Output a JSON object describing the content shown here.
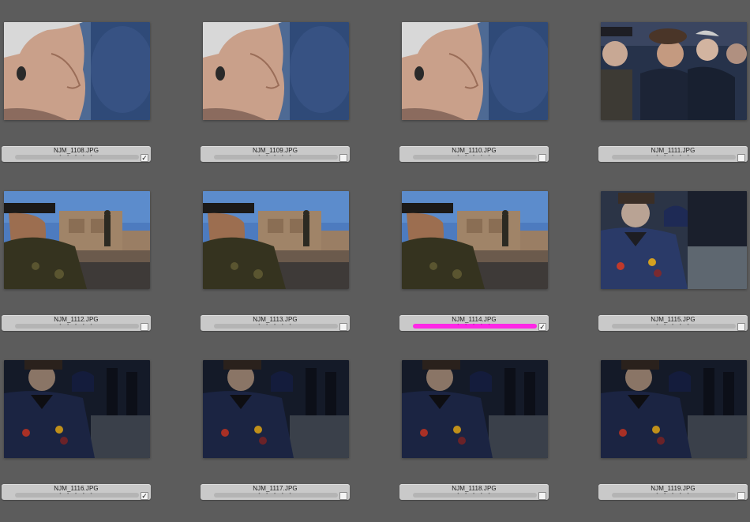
{
  "photos": [
    {
      "filename": "NJM_1108.JPG",
      "checked": true,
      "label_color": null,
      "subject": "man-profile-closeup"
    },
    {
      "filename": "NJM_1109.JPG",
      "checked": false,
      "label_color": null,
      "subject": "man-profile-closeup"
    },
    {
      "filename": "NJM_1110.JPG",
      "checked": false,
      "label_color": null,
      "subject": "man-profile-closeup"
    },
    {
      "filename": "NJM_1111.JPG",
      "checked": false,
      "label_color": null,
      "subject": "crowd-men-hats"
    },
    {
      "filename": "NJM_1112.JPG",
      "checked": false,
      "label_color": null,
      "subject": "soldier-memorial"
    },
    {
      "filename": "NJM_1113.JPG",
      "checked": false,
      "label_color": null,
      "subject": "soldier-memorial"
    },
    {
      "filename": "NJM_1114.JPG",
      "checked": true,
      "label_color": "#ff28e6",
      "subject": "soldier-memorial"
    },
    {
      "filename": "NJM_1115.JPG",
      "checked": false,
      "label_color": null,
      "subject": "veteran-medals"
    },
    {
      "filename": "NJM_1116.JPG",
      "checked": true,
      "label_color": null,
      "subject": "veteran-medals-dark"
    },
    {
      "filename": "NJM_1117.JPG",
      "checked": false,
      "label_color": null,
      "subject": "veteran-medals-dark"
    },
    {
      "filename": "NJM_1118.JPG",
      "checked": false,
      "label_color": null,
      "subject": "veteran-medals-dark"
    },
    {
      "filename": "NJM_1119.JPG",
      "checked": false,
      "label_color": null,
      "subject": "veteran-medals-dark"
    }
  ],
  "rating_dots": "• • • • •",
  "background_color": "#5c5c5c"
}
